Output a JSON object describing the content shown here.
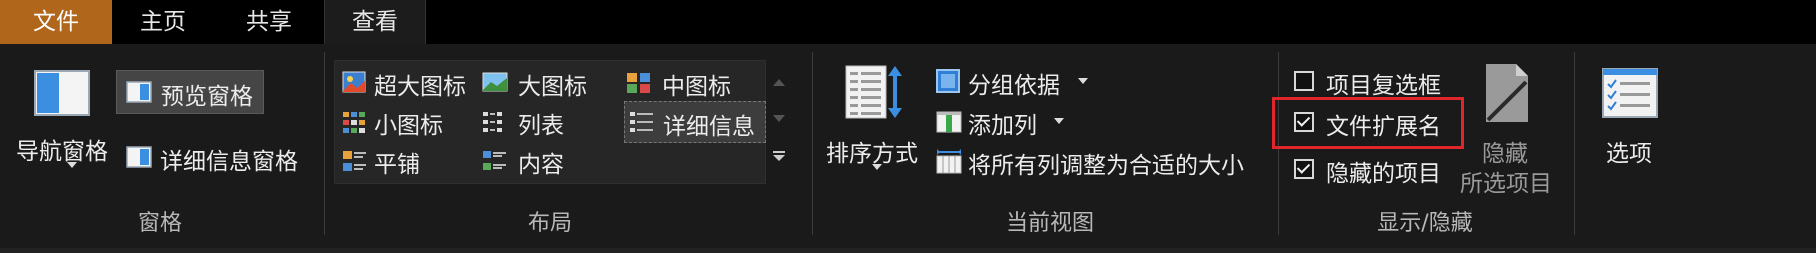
{
  "tabs": {
    "file": "文件",
    "home": "主页",
    "share": "共享",
    "view": "查看"
  },
  "panes": {
    "nav_pane": "导航窗格",
    "preview_pane": "预览窗格",
    "details_pane": "详细信息窗格",
    "group_label": "窗格"
  },
  "layout": {
    "extra_large": "超大图标",
    "large": "大图标",
    "medium": "中图标",
    "small": "小图标",
    "list": "列表",
    "details": "详细信息",
    "tiles": "平铺",
    "content": "内容",
    "group_label": "布局"
  },
  "current_view": {
    "sort_by": "排序方式",
    "group_by": "分组依据",
    "add_columns": "添加列",
    "size_all_columns": "将所有列调整为合适的大小",
    "group_label": "当前视图"
  },
  "show_hide": {
    "item_checkboxes": "项目复选框",
    "item_checkboxes_checked": false,
    "file_extensions": "文件扩展名",
    "file_extensions_checked": true,
    "hidden_items": "隐藏的项目",
    "hidden_items_checked": true,
    "hide_selected_line1": "隐藏",
    "hide_selected_line2": "所选项目",
    "group_label": "显示/隐藏"
  },
  "options": {
    "label": "选项"
  },
  "colors": {
    "file_tab": "#b0661b",
    "highlight_box": "#e0262a",
    "background": "#1a1a1a"
  }
}
